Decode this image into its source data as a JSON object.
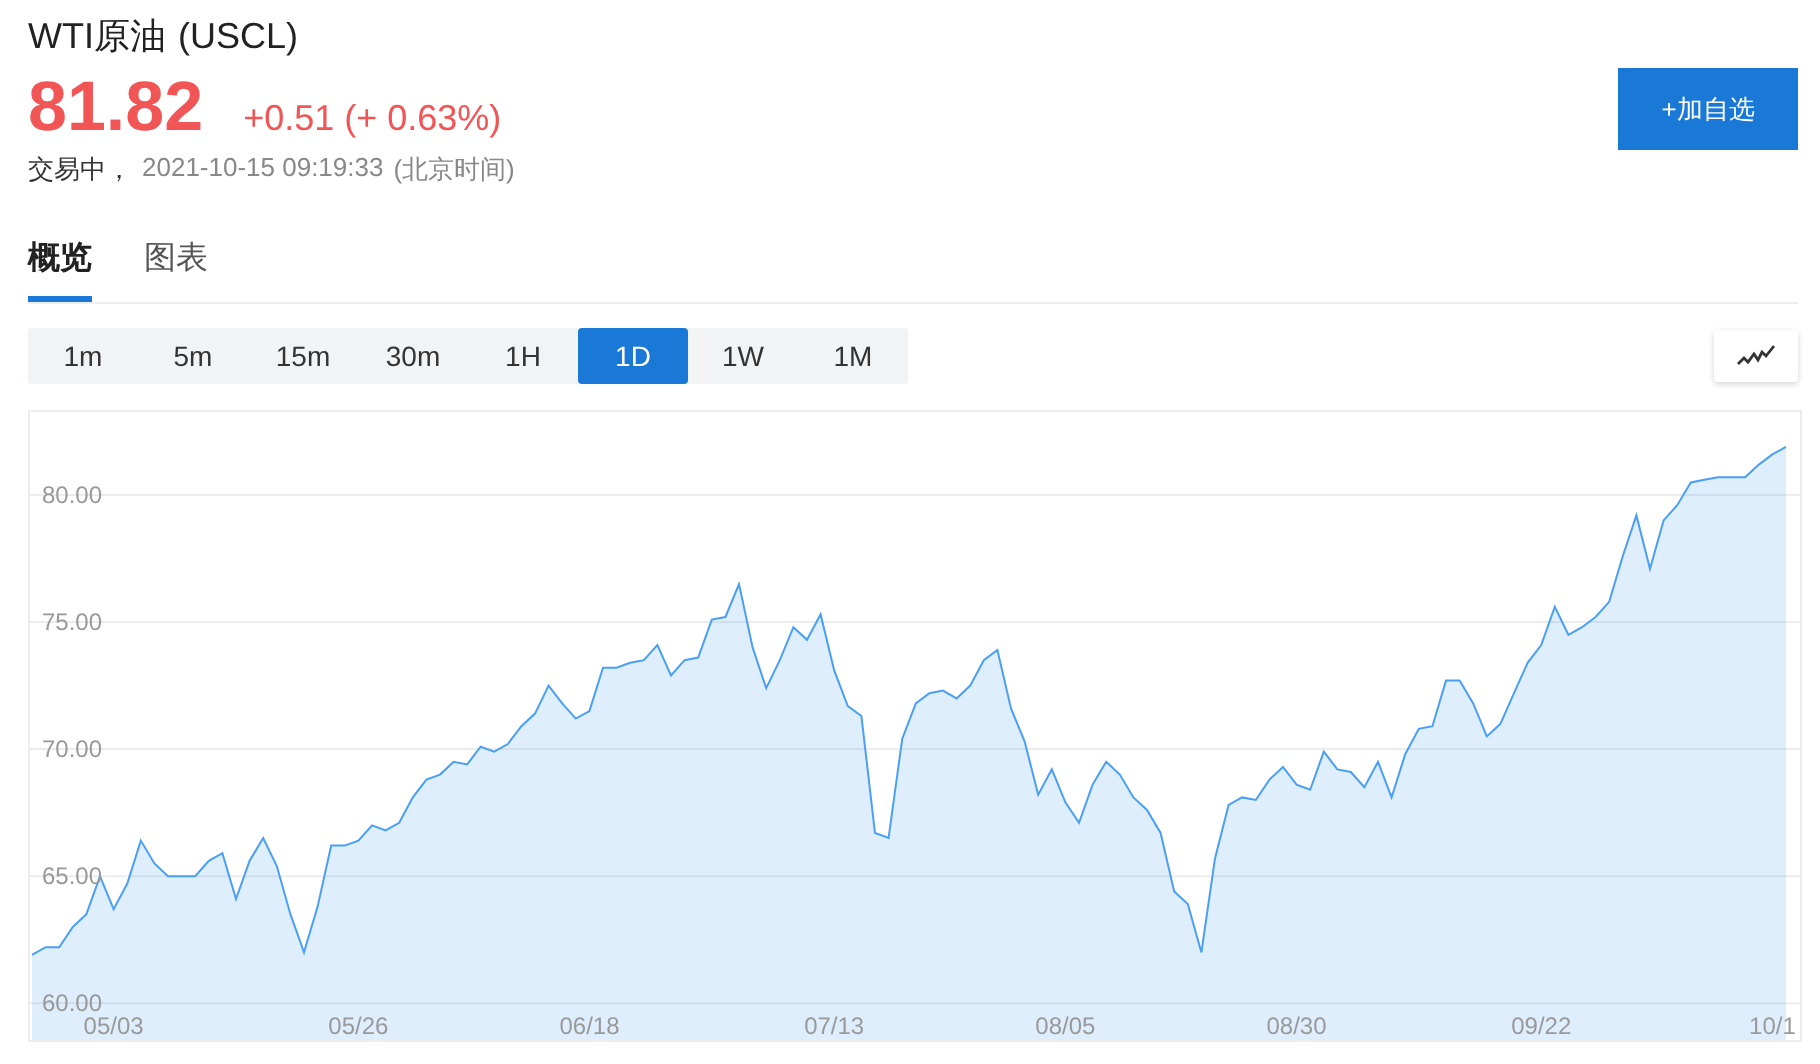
{
  "quote": {
    "name": "WTI原油",
    "code": "(USCL)",
    "price": "81.82",
    "change": "+0.51",
    "change_pct": "(+ 0.63%)",
    "status": "交易中，",
    "time": "2021-10-15 09:19:33",
    "timezone": "(北京时间)"
  },
  "watch_button": "+加自选",
  "tabs": [
    {
      "label": "概览",
      "selected": true
    },
    {
      "label": "图表",
      "selected": false
    }
  ],
  "periods": [
    {
      "label": "1m",
      "selected": false
    },
    {
      "label": "5m",
      "selected": false
    },
    {
      "label": "15m",
      "selected": false
    },
    {
      "label": "30m",
      "selected": false
    },
    {
      "label": "1H",
      "selected": false
    },
    {
      "label": "1D",
      "selected": true
    },
    {
      "label": "1W",
      "selected": false
    },
    {
      "label": "1M",
      "selected": false
    }
  ],
  "chart_data": {
    "type": "area",
    "categories": [
      null,
      null,
      null,
      null,
      null,
      null,
      "05/03",
      null,
      null,
      null,
      null,
      null,
      null,
      null,
      null,
      null,
      null,
      null,
      null,
      null,
      null,
      null,
      null,
      null,
      "05/26",
      null,
      null,
      null,
      null,
      null,
      null,
      null,
      null,
      null,
      null,
      null,
      null,
      null,
      null,
      null,
      null,
      "06/18",
      null,
      null,
      null,
      null,
      null,
      null,
      null,
      null,
      null,
      null,
      null,
      null,
      null,
      null,
      null,
      null,
      null,
      "07/13",
      null,
      null,
      null,
      null,
      null,
      null,
      null,
      null,
      null,
      null,
      null,
      null,
      null,
      null,
      null,
      null,
      "08/05",
      null,
      null,
      null,
      null,
      null,
      null,
      null,
      null,
      null,
      null,
      null,
      null,
      null,
      null,
      null,
      null,
      "08/30",
      null,
      null,
      null,
      null,
      null,
      null,
      null,
      null,
      null,
      null,
      null,
      null,
      null,
      null,
      null,
      null,
      null,
      "09/22",
      null,
      null,
      null,
      null,
      null,
      null,
      null,
      null,
      null,
      null,
      null,
      null,
      null,
      null,
      null,
      null,
      "10/1",
      null
    ],
    "series": [
      {
        "color": "#4a9ff5",
        "values": [
          61.9,
          62.2,
          62.2,
          63.0,
          63.5,
          65.0,
          63.7,
          64.7,
          66.4,
          65.5,
          65.0,
          65.0,
          65.0,
          65.6,
          65.9,
          64.1,
          65.6,
          66.5,
          65.4,
          63.5,
          62.0,
          63.8,
          66.2,
          66.2,
          66.4,
          67.0,
          66.8,
          67.1,
          68.1,
          68.8,
          69.0,
          69.5,
          69.4,
          70.1,
          69.9,
          70.2,
          70.9,
          71.4,
          72.5,
          71.8,
          71.2,
          71.5,
          73.2,
          73.2,
          73.4,
          73.5,
          74.1,
          72.9,
          73.5,
          73.6,
          75.1,
          75.2,
          76.5,
          74.0,
          72.4,
          73.5,
          74.8,
          74.3,
          75.3,
          73.1,
          71.7,
          71.3,
          66.7,
          66.5,
          70.4,
          71.8,
          72.2,
          72.3,
          72.0,
          72.5,
          73.5,
          73.9,
          71.6,
          70.3,
          68.2,
          69.2,
          67.9,
          67.1,
          68.6,
          69.5,
          69.0,
          68.1,
          67.6,
          66.7,
          64.4,
          63.9,
          62.0,
          65.7,
          67.8,
          68.1,
          68.0,
          68.8,
          69.3,
          68.6,
          68.4,
          69.9,
          69.2,
          69.1,
          68.5,
          69.5,
          68.1,
          69.8,
          70.8,
          70.9,
          72.7,
          72.7,
          71.8,
          70.5,
          71.0,
          72.2,
          73.4,
          74.1,
          75.6,
          74.5,
          74.8,
          75.2,
          75.8,
          77.6,
          79.2,
          77.1,
          79.0,
          79.6,
          80.5,
          80.6,
          80.7,
          80.7,
          80.7,
          81.2,
          81.6,
          81.9
        ]
      }
    ],
    "ylim": [
      58.55,
      83.27
    ],
    "grid": true,
    "yticks": [
      {
        "value": 60,
        "label": "60.00"
      },
      {
        "value": 65,
        "label": "65.00"
      },
      {
        "value": 70,
        "label": "70.00"
      },
      {
        "value": 75,
        "label": "75.00"
      },
      {
        "value": 80,
        "label": "80.00"
      }
    ]
  }
}
